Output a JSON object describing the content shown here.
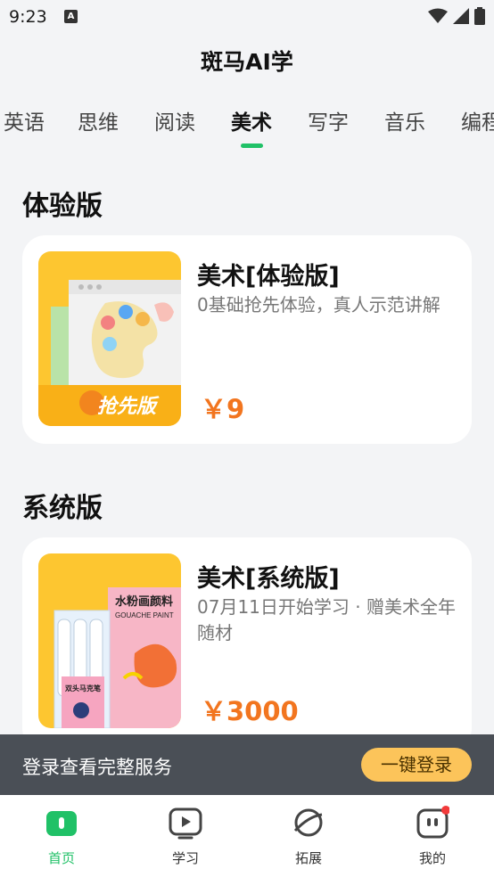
{
  "status": {
    "time": "9:23"
  },
  "app_title": "斑马AI学",
  "tabs": [
    {
      "label": "英语"
    },
    {
      "label": "思维"
    },
    {
      "label": "阅读"
    },
    {
      "label": "美术",
      "active": true
    },
    {
      "label": "写字"
    },
    {
      "label": "音乐"
    },
    {
      "label": "编程"
    }
  ],
  "sections": {
    "trial": {
      "title": "体验版",
      "card": {
        "title": "美术[体验版]",
        "desc": "0基础抢先体验，真人示范讲解",
        "price": "￥9",
        "badge": "抢先版"
      }
    },
    "system": {
      "title": "系统版",
      "card": {
        "title": "美术[系统版]",
        "desc": "07月11日开始学习 · 赠美术全年随材",
        "price": "￥3000",
        "box_label_cn": "水粉画颜料",
        "box_label_en": "GOUACHE PAINT",
        "marker_label": "双头马克笔"
      }
    }
  },
  "login_bar": {
    "text": "登录查看完整服务",
    "button": "一键登录"
  },
  "bottom_nav": [
    {
      "label": "首页",
      "icon": "home-icon",
      "active": true
    },
    {
      "label": "学习",
      "icon": "play-icon"
    },
    {
      "label": "拓展",
      "icon": "planet-icon"
    },
    {
      "label": "我的",
      "icon": "profile-icon"
    }
  ],
  "colors": {
    "accent": "#20c167",
    "price": "#f2751f",
    "login_button": "#fcc45a"
  }
}
